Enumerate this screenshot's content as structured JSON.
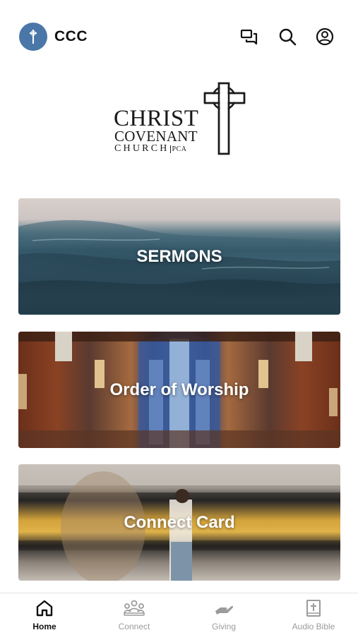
{
  "header": {
    "app_name": "CCC",
    "icons": [
      "cross-icon",
      "chat-icon",
      "search-icon",
      "account-icon"
    ]
  },
  "logo": {
    "line1": "CHRIST",
    "line2": "COVENANT",
    "line3": "CHURCH",
    "suffix": "PCA"
  },
  "cards": [
    {
      "label": "SERMONS"
    },
    {
      "label": "Order of Worship"
    },
    {
      "label": "Connect Card"
    }
  ],
  "bottom_nav": {
    "items": [
      {
        "label": "Home",
        "icon": "home-icon",
        "active": true
      },
      {
        "label": "Connect",
        "icon": "people-icon",
        "active": false
      },
      {
        "label": "Giving",
        "icon": "giving-hand-icon",
        "active": false
      },
      {
        "label": "Audio Bible",
        "icon": "bible-icon",
        "active": false
      }
    ]
  },
  "colors": {
    "avatar_bg": "#4a77a8",
    "active_nav": "#111111",
    "inactive_nav": "#9b9b9b"
  }
}
